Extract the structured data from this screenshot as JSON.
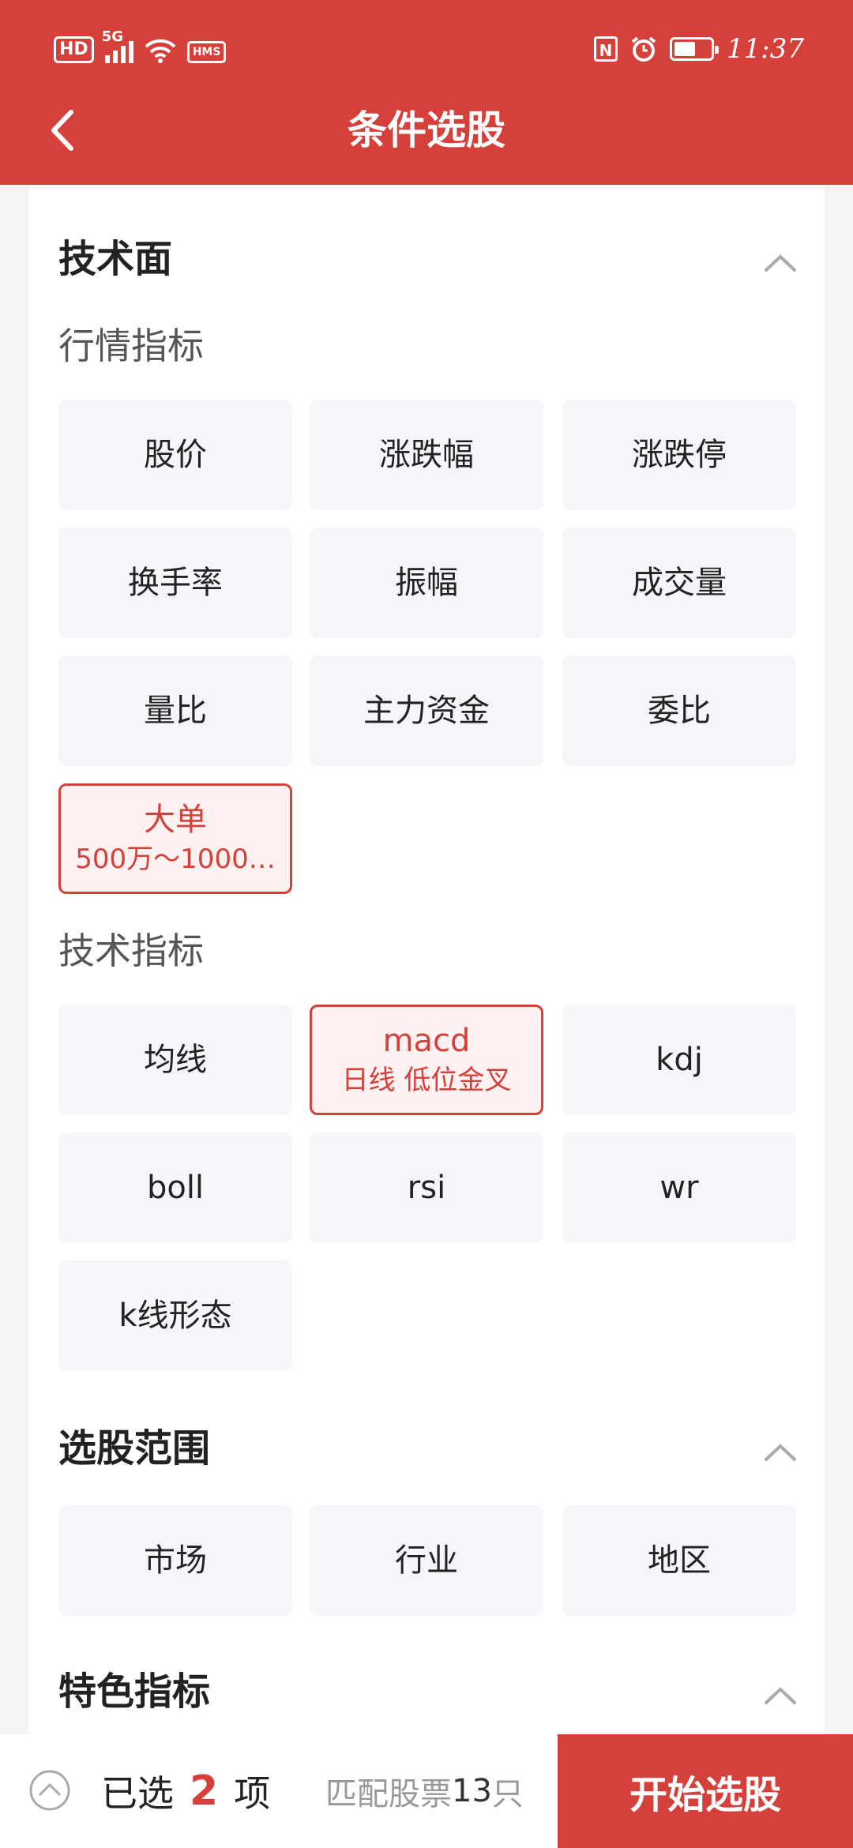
{
  "status_bar": {
    "hd": "HD",
    "network": "5G",
    "hms": "HMS",
    "nfc": "N",
    "battery_level": 0.6,
    "time": "11:37"
  },
  "header": {
    "title": "条件选股",
    "back_icon": "chevron-left-icon"
  },
  "sections": {
    "technical": {
      "title": "技术面",
      "icon": "chevron-up-icon",
      "market_indicators": {
        "title": "行情指标",
        "items": [
          {
            "label": "股价"
          },
          {
            "label": "涨跌幅"
          },
          {
            "label": "涨跌停"
          },
          {
            "label": "换手率"
          },
          {
            "label": "振幅"
          },
          {
            "label": "成交量"
          },
          {
            "label": "量比"
          },
          {
            "label": "主力资金"
          },
          {
            "label": "委比"
          },
          {
            "label": "大单",
            "sub": "500万～1000…",
            "selected": true
          }
        ]
      },
      "tech_indicators": {
        "title": "技术指标",
        "items": [
          {
            "label": "均线"
          },
          {
            "label": "macd",
            "sub": "日线 低位金叉",
            "selected": true
          },
          {
            "label": "kdj"
          },
          {
            "label": "boll"
          },
          {
            "label": "rsi"
          },
          {
            "label": "wr"
          },
          {
            "label": "k线形态"
          }
        ]
      }
    },
    "scope": {
      "title": "选股范围",
      "icon": "chevron-up-icon",
      "items": [
        {
          "label": "市场"
        },
        {
          "label": "行业"
        },
        {
          "label": "地区"
        }
      ]
    },
    "special": {
      "title": "特色指标",
      "icon": "chevron-up-icon"
    }
  },
  "bottom_bar": {
    "toggle_icon": "chevron-up-circle-icon",
    "selected_prefix": "已选",
    "selected_count": "2",
    "selected_suffix": "项",
    "match_prefix": "匹配股票",
    "match_count": "13",
    "match_suffix": "只",
    "start_label": "开始选股"
  },
  "colors": {
    "brand": "#d6403a",
    "tile_bg": "#f5f6f9",
    "selected_bg": "#fdf1f1"
  }
}
